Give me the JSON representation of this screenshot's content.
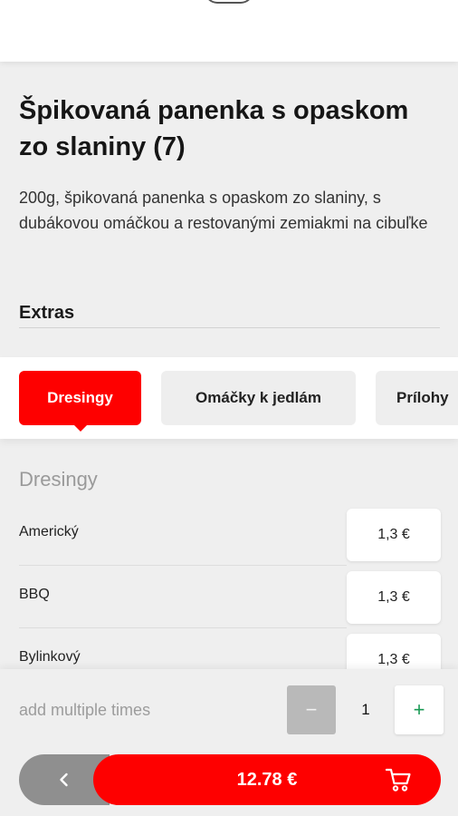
{
  "dish": {
    "title": "Špikovaná panenka s opaskom zo slaniny (7)",
    "description": "200g, špikovaná panenka s opaskom zo slaniny, s dubákovou omáčkou a restovanými zemiakmi na cibuľke"
  },
  "extras": {
    "label": "Extras",
    "tabs": [
      {
        "label": "Dresingy",
        "active": true
      },
      {
        "label": "Omáčky k jedlám",
        "active": false
      },
      {
        "label": "Prílohy",
        "active": false
      }
    ],
    "section_title": "Dresingy",
    "items": [
      {
        "name": "Americký",
        "price": "1,3 €"
      },
      {
        "name": "BBQ",
        "price": "1,3 €"
      },
      {
        "name": "Bylinkový",
        "price": "1,3 €"
      }
    ]
  },
  "footer": {
    "multi_label": "add multiple times",
    "quantity": "1",
    "minus_symbol": "−",
    "plus_symbol": "+",
    "total": "12.78 €"
  },
  "colors": {
    "accent": "#fe0000",
    "plus": "#1a9a55",
    "back_button": "#8f8f8f",
    "minus_button": "#b9b9b9"
  },
  "icons": {
    "back": "chevron-left-icon",
    "cart": "cart-icon"
  }
}
